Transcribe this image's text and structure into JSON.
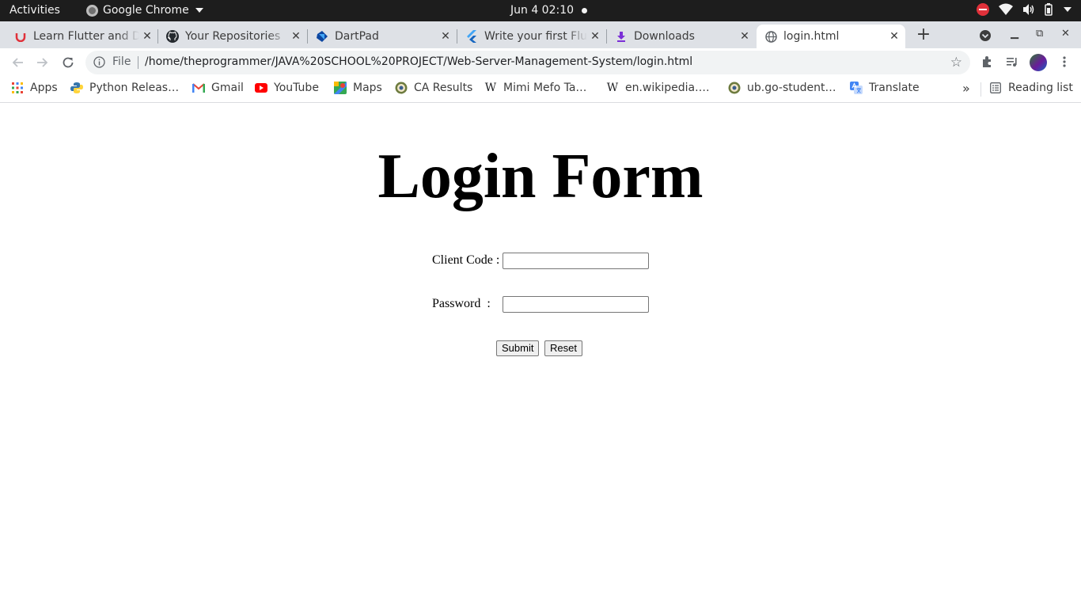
{
  "os_bar": {
    "activities": "Activities",
    "app_name": "Google Chrome",
    "clock": "Jun 4  02:10"
  },
  "tabs": [
    {
      "title": "Learn Flutter and Dart",
      "icon": "udemy-icon"
    },
    {
      "title": "Your Repositories",
      "icon": "github-icon"
    },
    {
      "title": "DartPad",
      "icon": "dartpad-icon"
    },
    {
      "title": "Write your first Flutter app",
      "icon": "flutter-icon"
    },
    {
      "title": "Downloads",
      "icon": "download-icon"
    },
    {
      "title": "login.html",
      "icon": "globe-icon",
      "active": true
    }
  ],
  "toolbar": {
    "scheme_label": "File",
    "url": "/home/theprogrammer/JAVA%20SCHOOL%20PROJECT/Web-Server-Management-System/login.html"
  },
  "bookmarks": [
    {
      "label": "Apps",
      "icon": "apps-grid-icon"
    },
    {
      "label": "Python Releas…",
      "icon": "python-icon"
    },
    {
      "label": "Gmail",
      "icon": "gmail-icon"
    },
    {
      "label": "YouTube",
      "icon": "youtube-icon"
    },
    {
      "label": "Maps",
      "icon": "maps-icon"
    },
    {
      "label": "CA Results",
      "icon": "seal-icon"
    },
    {
      "label": "Mimi Mefo Ta…",
      "icon": "wikipedia-icon"
    },
    {
      "label": "en.wikipedia.…",
      "icon": "wikipedia-icon"
    },
    {
      "label": "ub.go-student…",
      "icon": "seal-icon"
    },
    {
      "label": "Translate",
      "icon": "translate-icon"
    }
  ],
  "bookmarks_more": "»",
  "reading_list": "Reading list",
  "colors": {
    "accent_red": "#e0313a",
    "tab_strip": "#dee1e6",
    "omnibox": "#f1f3f4"
  },
  "page": {
    "heading": "Login Form",
    "client_code_label": "Client Code :",
    "password_label": "Password  :",
    "client_code_value": "",
    "password_value": "",
    "submit_label": "Submit",
    "reset_label": "Reset"
  }
}
